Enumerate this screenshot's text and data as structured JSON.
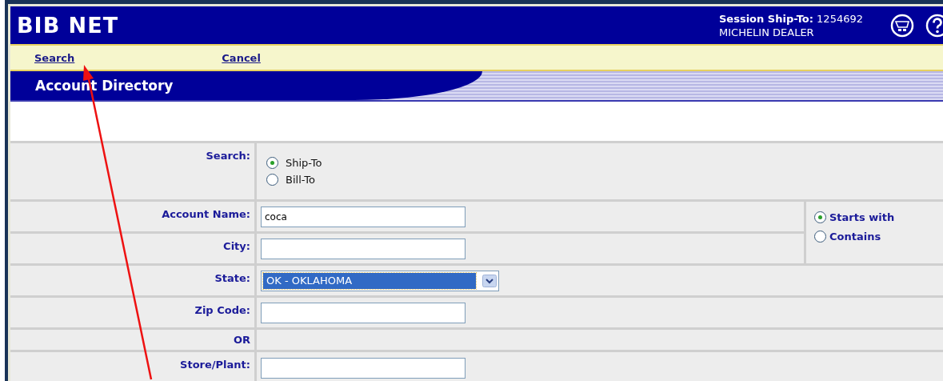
{
  "header": {
    "logo": "BIB NET",
    "session_label": "Session Ship-To:",
    "session_value": "1254692",
    "dealer": "MICHELIN DEALER"
  },
  "toolbar": [
    {
      "label": "Search"
    },
    {
      "label": "Cancel"
    }
  ],
  "page_title": "Account Directory",
  "form": {
    "search": {
      "label": "Search:",
      "options": [
        {
          "label": "Ship-To",
          "selected": true
        },
        {
          "label": "Bill-To",
          "selected": false
        }
      ]
    },
    "account_name": {
      "label": "Account Name:",
      "value": "coca"
    },
    "city": {
      "label": "City:"
    },
    "state": {
      "label": "State:",
      "value": "OK - OKLAHOMA"
    },
    "zip_code": {
      "label": "Zip Code:"
    },
    "or_label": "OR",
    "store_plant": {
      "label": "Store/Plant:"
    },
    "match": [
      {
        "label": "Starts with",
        "selected": true
      },
      {
        "label": "Contains",
        "selected": false
      }
    ]
  }
}
